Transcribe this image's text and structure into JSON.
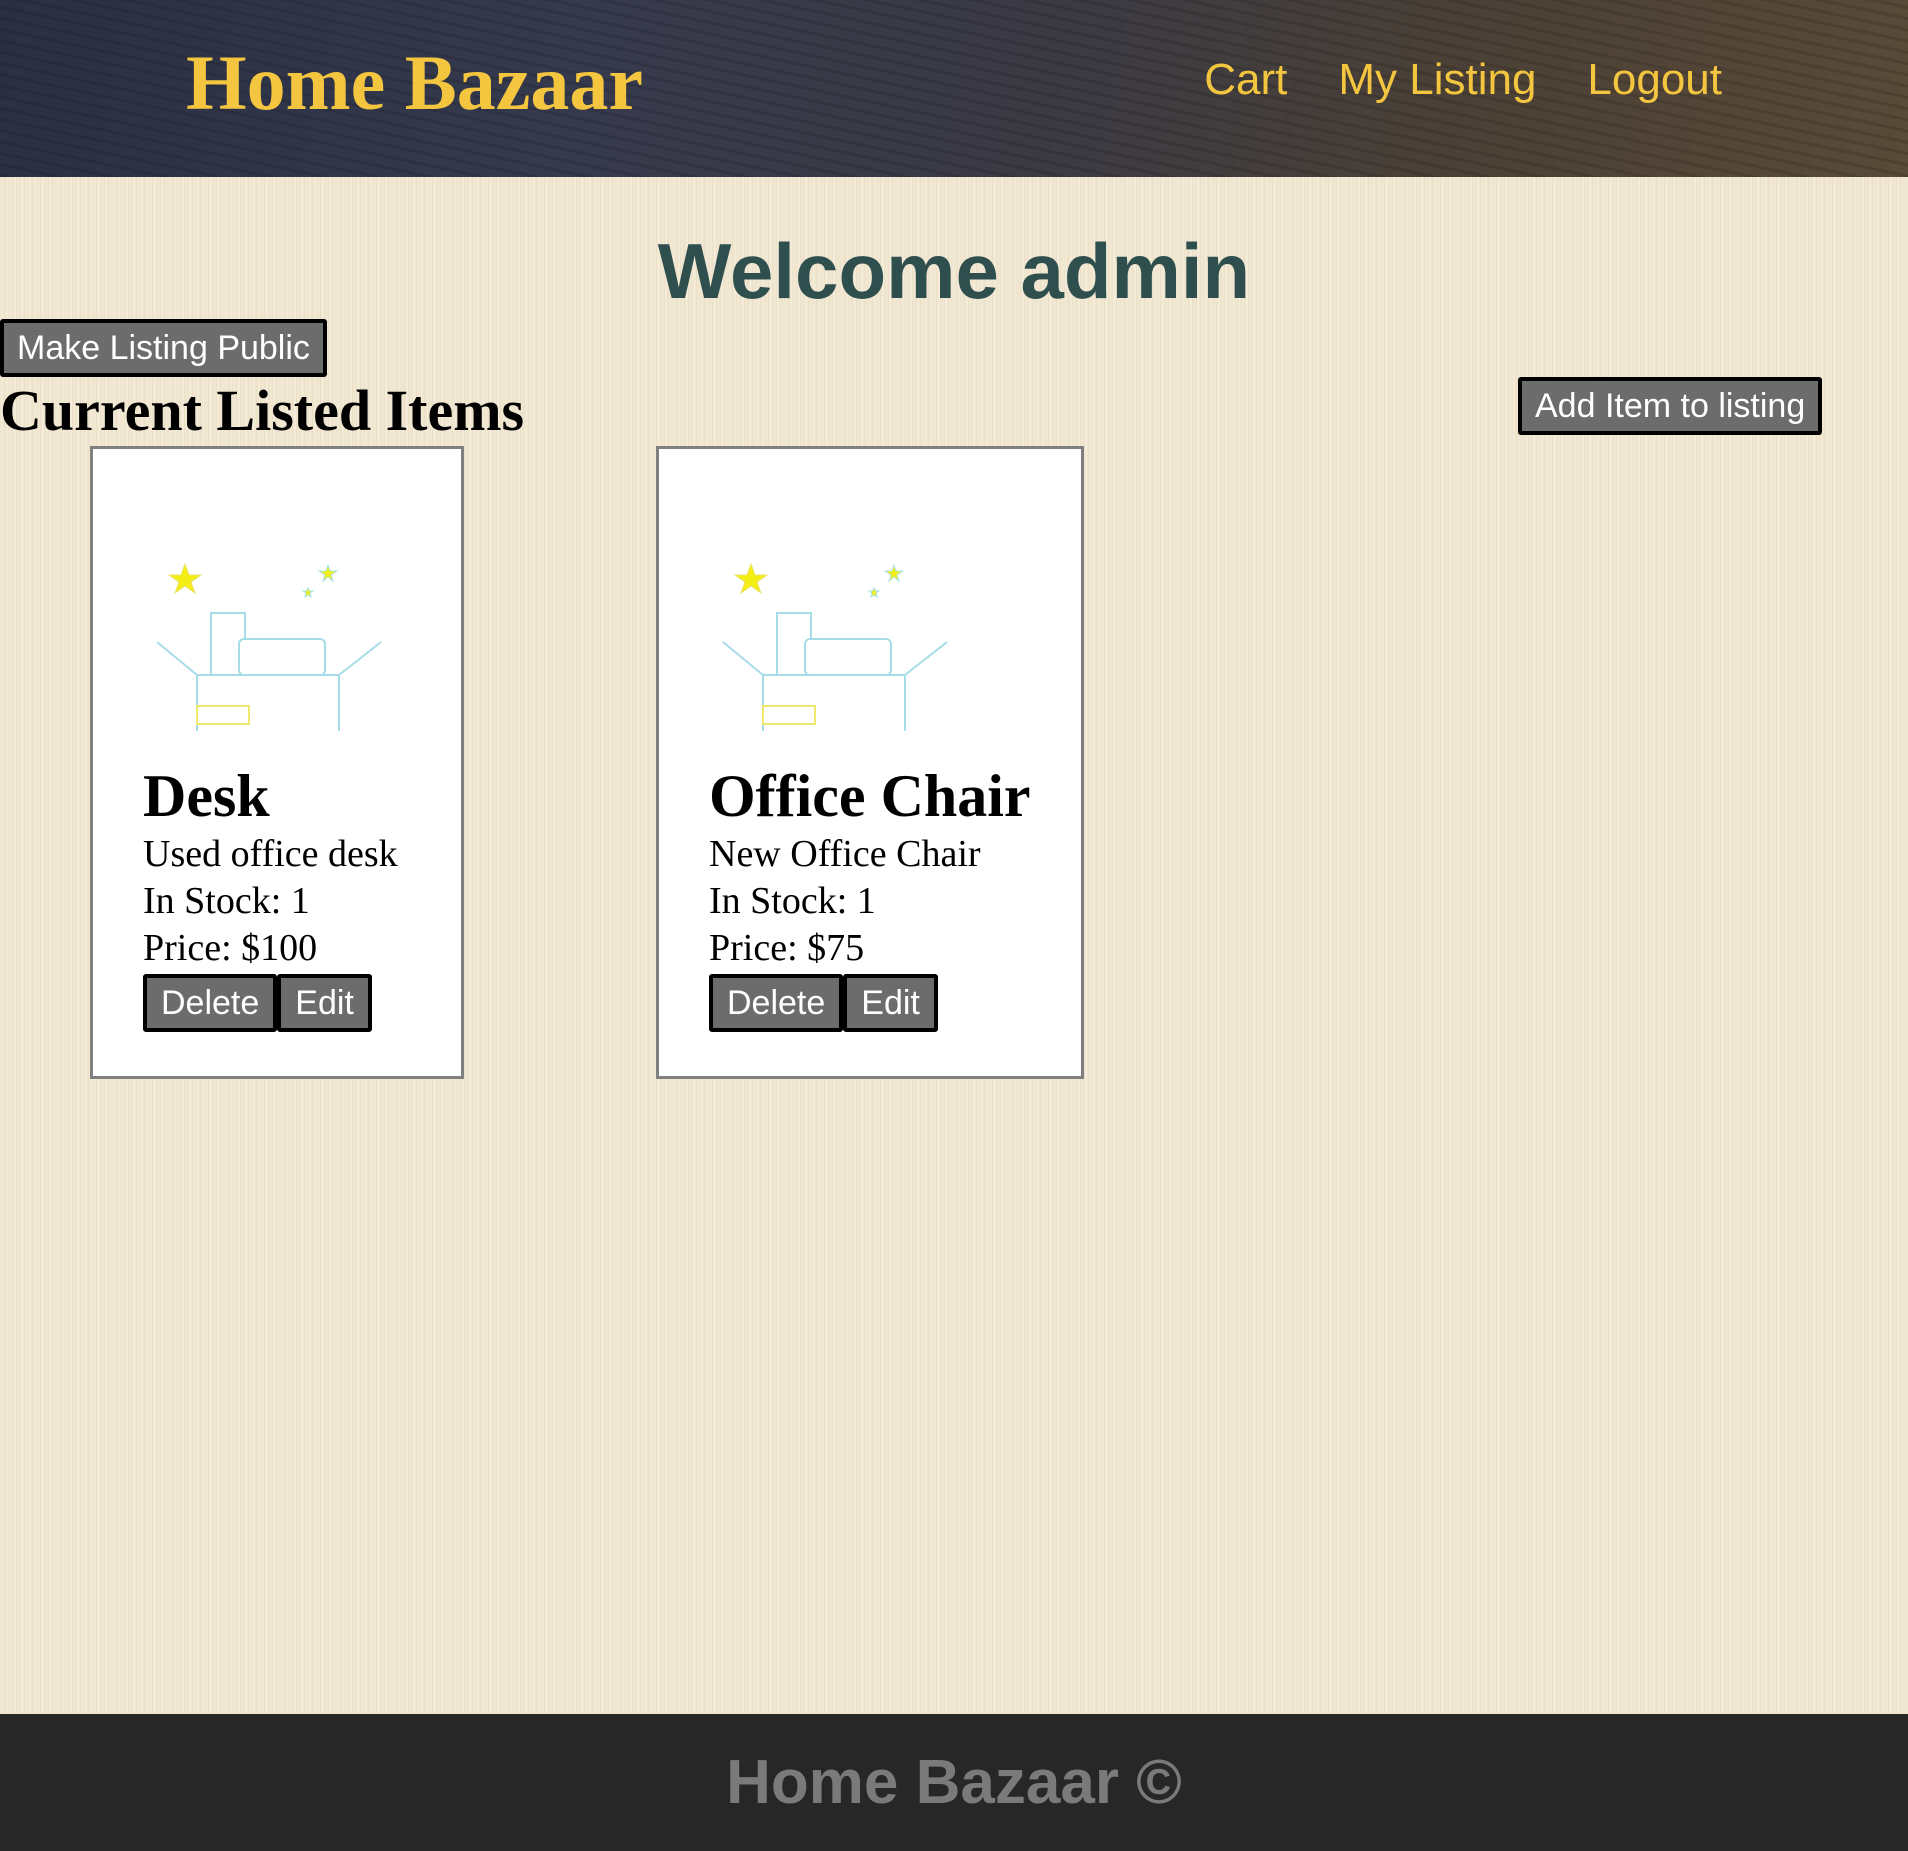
{
  "header": {
    "brand": "Home Bazaar",
    "nav": [
      "Cart",
      "My Listing",
      "Logout"
    ],
    "text_color": "#f4c53f"
  },
  "main": {
    "welcome": "Welcome admin",
    "make_public_label": "Make Listing Public",
    "section_title": "Current Listed Items",
    "add_item_label": "Add Item to listing",
    "items": [
      {
        "name": "Desk",
        "description": "Used office desk",
        "stock": "In Stock: 1",
        "price": "Price: $100",
        "delete_label": "Delete",
        "edit_label": "Edit",
        "image_icon": "open-box-icon"
      },
      {
        "name": "Office Chair",
        "description": "New Office Chair",
        "stock": "In Stock: 1",
        "price": "Price: $75",
        "delete_label": "Delete",
        "edit_label": "Edit",
        "image_icon": "open-box-icon"
      }
    ]
  },
  "footer": {
    "text": "Home Bazaar ©"
  },
  "colors": {
    "welcome": "#2f4f4f",
    "button_bg": "#6c6c6c",
    "footer_bg": "#272727"
  }
}
